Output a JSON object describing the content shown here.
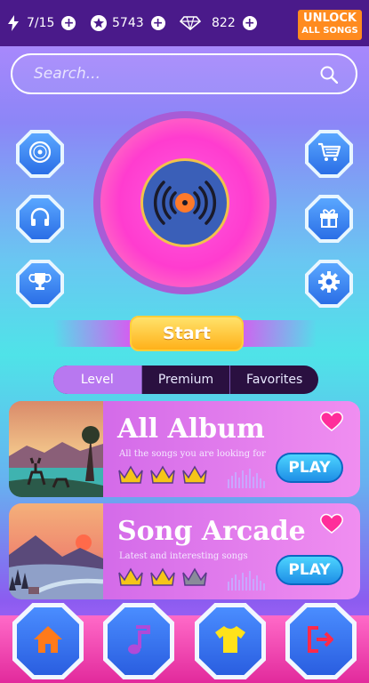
{
  "topbar": {
    "energy": "7/15",
    "stars": "5743",
    "gems": "822",
    "unlock_line1": "UNLOCK",
    "unlock_line2": "ALL SONGS"
  },
  "search": {
    "placeholder": "Search..."
  },
  "start_label": "Start",
  "tabs": [
    {
      "label": "Level"
    },
    {
      "label": "Premium"
    },
    {
      "label": "Favorites"
    }
  ],
  "cards": [
    {
      "title": "All Album",
      "subtitle": "All the songs you are looking for",
      "play_label": "PLAY",
      "crowns_filled": 3,
      "crowns_total": 3
    },
    {
      "title": "Song Arcade",
      "subtitle": "Latest and interesting songs",
      "play_label": "PLAY",
      "crowns_filled": 2,
      "crowns_total": 3
    }
  ],
  "icons": {
    "left_buttons": [
      "disc-icon",
      "headphones-icon",
      "trophy-icon"
    ],
    "right_buttons": [
      "cart-icon",
      "gift-icon",
      "gear-icon"
    ],
    "nav": [
      "home-icon",
      "music-note-icon",
      "shirt-icon",
      "exit-icon"
    ]
  },
  "colors": {
    "accent": "#4a1a8a",
    "unlock": "#ff8b1f",
    "start": "#ffb11a",
    "crown": "#f5c518"
  }
}
